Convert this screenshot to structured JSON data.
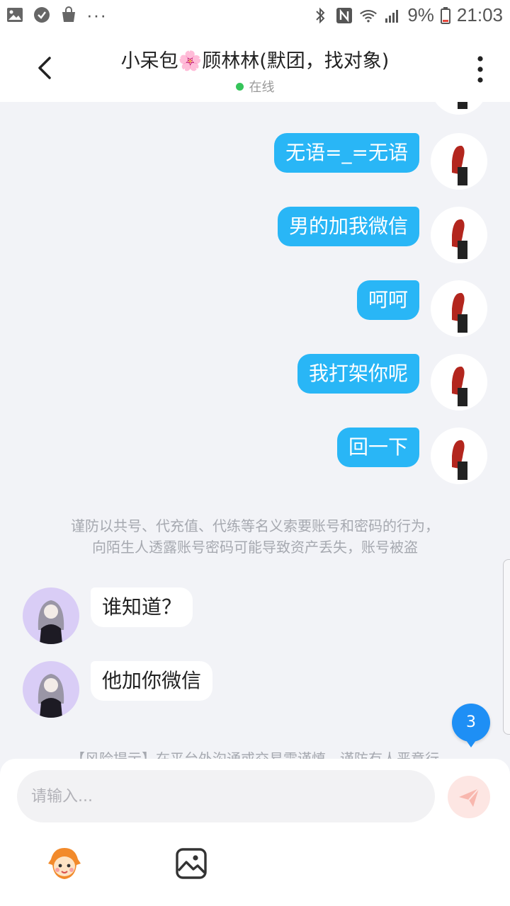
{
  "status_bar": {
    "battery": "9%",
    "time": "21:03",
    "more_dots": "···"
  },
  "header": {
    "title": "小呆包🌸顾林林(默团，找对象)",
    "status": "在线"
  },
  "messages": [
    {
      "side": "right",
      "text": "无语=_=无语"
    },
    {
      "side": "right",
      "text": "男的加我微信"
    },
    {
      "side": "right",
      "text": "呵呵"
    },
    {
      "side": "right",
      "text": "我打架你呢"
    },
    {
      "side": "right",
      "text": "回一下"
    },
    {
      "side": "left",
      "text": "谁知道？"
    },
    {
      "side": "left",
      "text": "他加你微信"
    }
  ],
  "system_tip": {
    "line1": "谨防以共号、代充值、代练等名义索要账号和密码的行为，",
    "line2": "向陌生人透露账号密码可能导致资产丢失，账号被盗"
  },
  "risk_tip": "【风险提示】在平台外沟通或交易需谨慎，谨防有人恶意行",
  "unread_count": "3",
  "input": {
    "placeholder": "请输入..."
  },
  "colors": {
    "bubble_self": "#29b6f6",
    "bubble_other": "#ffffff",
    "online": "#35c45a",
    "badge": "#1e8ff5",
    "send_button": "#fde6e3"
  },
  "icons": {
    "back": "chevron-left-icon",
    "more": "more-vertical-icon",
    "send": "paper-plane-icon",
    "emoji": "emoji-face-icon",
    "image": "image-picker-icon"
  }
}
